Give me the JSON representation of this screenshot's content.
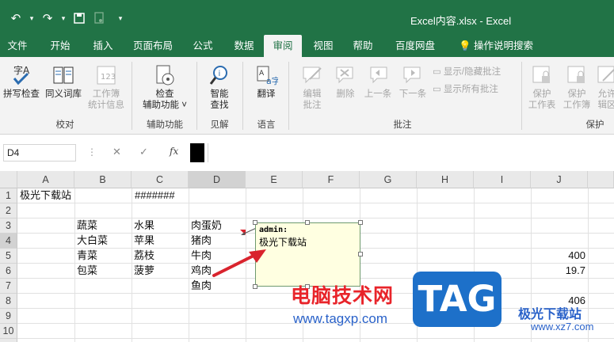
{
  "window": {
    "title": "Excel内容.xlsx  -  Excel"
  },
  "quick_access": {
    "undo_icon": "undo-icon",
    "redo_icon": "redo-icon",
    "save_icon": "save-icon",
    "touch_icon": "touch-mode-icon"
  },
  "tabs": [
    {
      "label": "文件"
    },
    {
      "label": "开始"
    },
    {
      "label": "插入"
    },
    {
      "label": "页面布局"
    },
    {
      "label": "公式"
    },
    {
      "label": "数据"
    },
    {
      "label": "审阅",
      "active": true
    },
    {
      "label": "视图"
    },
    {
      "label": "帮助"
    },
    {
      "label": "百度网盘"
    },
    {
      "label": "操作说明搜索"
    }
  ],
  "ribbon": {
    "spell": "拼写检查",
    "thesaurus": "同义词库",
    "workbook_stats_1": "工作簿",
    "workbook_stats_2": "统计信息",
    "group_proofing": "校对",
    "check_access_1": "检查",
    "check_access_2": "辅助功能 ˅",
    "group_access": "辅助功能",
    "smart_lookup_1": "智能",
    "smart_lookup_2": "查找",
    "group_insights": "见解",
    "translate": "翻译",
    "group_language": "语言",
    "edit_comment_1": "编辑",
    "edit_comment_2": "批注",
    "delete": "删除",
    "previous": "上一条",
    "next": "下一条",
    "show_hide": "显示/隐藏批注",
    "show_all": "显示所有批注",
    "group_comments": "批注",
    "protect_sheet_1": "保护",
    "protect_sheet_2": "工作表",
    "protect_wb_1": "保护",
    "protect_wb_2": "工作簿",
    "allow_edit_1": "允许",
    "allow_edit_2": "辑区",
    "group_protect": "保护"
  },
  "formula_bar": {
    "name_box": "D4",
    "dots": "⋮",
    "cancel": "✕",
    "enter": "✓",
    "fx": "fx"
  },
  "grid": {
    "columns": [
      "A",
      "B",
      "C",
      "D",
      "E",
      "F",
      "G",
      "H",
      "I",
      "J"
    ],
    "rows": [
      "1",
      "2",
      "3",
      "4",
      "5",
      "6",
      "7",
      "8",
      "9",
      "10",
      "11"
    ],
    "cells": {
      "A1": "极光下载站",
      "C1": "#######",
      "B3": "蔬菜",
      "C3": "水果",
      "D3": "肉蛋奶",
      "B4": "大白菜",
      "C4": "苹果",
      "D4": "猪肉",
      "B5": "青菜",
      "C5": "荔枝",
      "D5": "牛肉",
      "B6": "包菜",
      "C6": "菠萝",
      "D6": "鸡肉",
      "D7": "鱼肉",
      "J5": "400",
      "J6": "19.7",
      "J8": "406"
    }
  },
  "comment": {
    "author": "admin:",
    "text": "极光下载站"
  },
  "watermark": {
    "cn": "电脑技术网",
    "url": "www.tagxp.com",
    "logo": "TAG",
    "site": "极光下载站",
    "domain": "www.xz7.com"
  },
  "colors": {
    "excel_green": "#217346",
    "comment_bg": "#ffffe1",
    "arrow": "#d9232d"
  }
}
